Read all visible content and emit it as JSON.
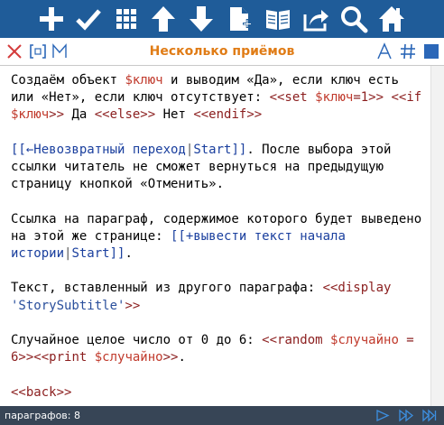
{
  "toolbar": {
    "buttons": [
      "add-icon",
      "check-icon",
      "grid-icon",
      "arrow-up-icon",
      "arrow-down-icon",
      "new-document-icon",
      "book-icon",
      "share-icon",
      "search-icon",
      "home-icon"
    ]
  },
  "titlebar": {
    "title": "Несколько приёмов",
    "icons_left": [
      "close-icon",
      "bracket-icon",
      "m-icon"
    ],
    "icons_right": [
      "font-icon",
      "hash-icon",
      "square-icon"
    ]
  },
  "editor": {
    "p1": {
      "t1": "Создаём объект ",
      "v1": "$ключ",
      "t2": " и выводим «Да», если ключ есть или «Нет», если ключ отсутствует: ",
      "m1": "<<set ",
      "v2": "$ключ",
      "m2": "=1>>",
      "m3": "<<if ",
      "v3": "$ключ",
      "m4": ">>",
      "t3": " Да ",
      "m5": "<<else>>",
      "t4": " Нет ",
      "m6": "<<endif>>"
    },
    "p2": {
      "b1": "[[",
      "l1": "←Невозвратный переход",
      "pipe": "|",
      "target": "Start",
      "b2": "]]",
      "t1": ". После выбора этой ссылки читатель не сможет вернуться на предыдущую страницу кнопкой «Отменить»."
    },
    "p3": {
      "t1": "Ссылка на параграф, содержимое которого будет выведено на этой же странице: ",
      "b1": "[[",
      "l1": "+вывести текст начала истории",
      "pipe": "|",
      "target": "Start",
      "b2": "]]",
      "t2": "."
    },
    "p4": {
      "t1": "Текст, вставленный из другого параграфа: ",
      "m1": "<<display ",
      "s1": "'StorySubtitle'",
      "m2": ">>"
    },
    "p5": {
      "t1": "Случайное целое число от 0 до 6: ",
      "m1": "<<random ",
      "v1": "$случайно",
      "m2": " = 6>>",
      "m3": "<<print ",
      "v2": "$случайно",
      "m4": ">>",
      "t2": "."
    },
    "p6": {
      "m1": "<<back>>"
    }
  },
  "statusbar": {
    "paragraph_count": "параграфов: 8",
    "icons": [
      "play-icon",
      "fast-forward-icon",
      "skip-to-end-icon"
    ]
  },
  "colors": {
    "toolbar_bg": "#1f5c99",
    "title": "#e07c16",
    "macro": "#8b1e1e",
    "variable": "#c0392b",
    "link": "#1a3f9e",
    "statusbar_bg": "#374556"
  }
}
